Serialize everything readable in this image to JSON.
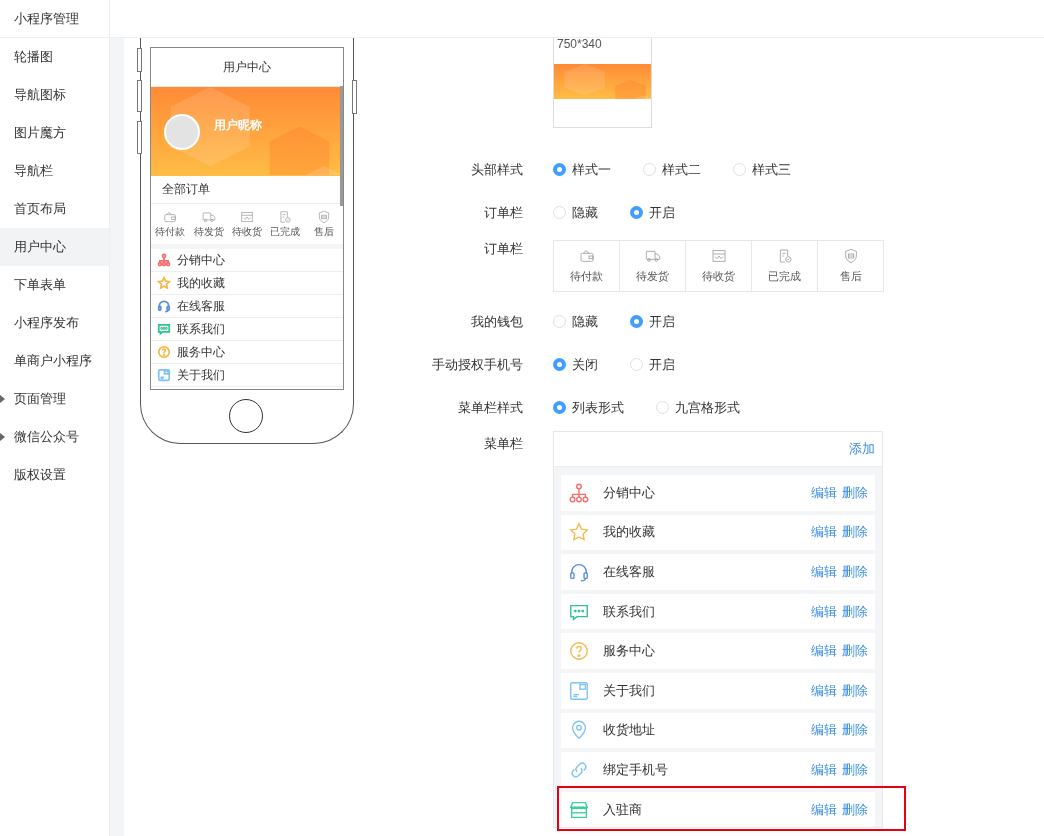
{
  "sidebar": {
    "title": "小程序管理",
    "items": [
      {
        "label": "轮播图",
        "kind": "link",
        "selected": false
      },
      {
        "label": "导航图标",
        "kind": "link",
        "selected": false
      },
      {
        "label": "图片魔方",
        "kind": "link",
        "selected": false
      },
      {
        "label": "导航栏",
        "kind": "link",
        "selected": false
      },
      {
        "label": "首页布局",
        "kind": "link",
        "selected": false
      },
      {
        "label": "用户中心",
        "kind": "link",
        "selected": true
      },
      {
        "label": "下单表单",
        "kind": "link",
        "selected": false
      },
      {
        "label": "小程序发布",
        "kind": "link",
        "selected": false
      },
      {
        "label": "单商户小程序",
        "kind": "link",
        "selected": false
      },
      {
        "label": "页面管理",
        "kind": "group",
        "selected": false
      },
      {
        "label": "微信公众号",
        "kind": "group",
        "selected": false
      },
      {
        "label": "版权设置",
        "kind": "link",
        "selected": false
      }
    ]
  },
  "phone": {
    "title": "用户中心",
    "nickname": "用户昵称",
    "all_orders": "全部订单",
    "order_tabs": [
      "待付款",
      "待发货",
      "待收货",
      "已完成",
      "售后"
    ],
    "menu": [
      {
        "label": "分销中心",
        "color": "#f56c6c"
      },
      {
        "label": "我的收藏",
        "color": "#f7b84b"
      },
      {
        "label": "在线客服",
        "color": "#5b8fd6"
      },
      {
        "label": "联系我们",
        "color": "#2fc28a"
      },
      {
        "label": "服务中心",
        "color": "#f7b84b"
      },
      {
        "label": "关于我们",
        "color": "#7ec3f5"
      }
    ]
  },
  "header_image": {
    "size": "750*340"
  },
  "settings": [
    {
      "kind": "radio",
      "label": "头部样式",
      "options": [
        {
          "label": "样式一",
          "selected": true
        },
        {
          "label": "样式二",
          "selected": false
        },
        {
          "label": "样式三",
          "selected": false
        }
      ]
    },
    {
      "kind": "radio",
      "label": "订单栏",
      "options": [
        {
          "label": "隐藏",
          "selected": false
        },
        {
          "label": "开启",
          "selected": true
        }
      ]
    },
    {
      "kind": "order-grid",
      "label": "订单栏",
      "items": [
        "待付款",
        "待发货",
        "待收货",
        "已完成",
        "售后"
      ]
    },
    {
      "kind": "radio",
      "label": "我的钱包",
      "options": [
        {
          "label": "隐藏",
          "selected": false
        },
        {
          "label": "开启",
          "selected": true
        }
      ]
    },
    {
      "kind": "radio",
      "label": "手动授权手机号",
      "options": [
        {
          "label": "关闭",
          "selected": true
        },
        {
          "label": "开启",
          "selected": false
        }
      ]
    },
    {
      "kind": "radio",
      "label": "菜单栏样式",
      "options": [
        {
          "label": "列表形式",
          "selected": true
        },
        {
          "label": "九宫格形式",
          "selected": false
        }
      ]
    },
    {
      "kind": "menu-list",
      "label": "菜单栏",
      "add": "添加",
      "items": [
        {
          "label": "分销中心",
          "color": "#f56c6c",
          "edit": "编辑",
          "delete": "删除",
          "highlighted": false
        },
        {
          "label": "我的收藏",
          "color": "#f7b84b",
          "edit": "编辑",
          "delete": "删除",
          "highlighted": false
        },
        {
          "label": "在线客服",
          "color": "#5b8fd6",
          "edit": "编辑",
          "delete": "删除",
          "highlighted": false
        },
        {
          "label": "联系我们",
          "color": "#2fc28a",
          "edit": "编辑",
          "delete": "删除",
          "highlighted": false
        },
        {
          "label": "服务中心",
          "color": "#f7b84b",
          "edit": "编辑",
          "delete": "删除",
          "highlighted": false
        },
        {
          "label": "关于我们",
          "color": "#7ec3f5",
          "edit": "编辑",
          "delete": "删除",
          "highlighted": false
        },
        {
          "label": "收货地址",
          "color": "#7ec3f5",
          "edit": "编辑",
          "delete": "删除",
          "highlighted": false
        },
        {
          "label": "绑定手机号",
          "color": "#7ec3f5",
          "edit": "编辑",
          "delete": "删除",
          "highlighted": false
        },
        {
          "label": "入驻商",
          "color": "#3fcf9a",
          "edit": "编辑",
          "delete": "删除",
          "highlighted": true
        }
      ]
    }
  ]
}
